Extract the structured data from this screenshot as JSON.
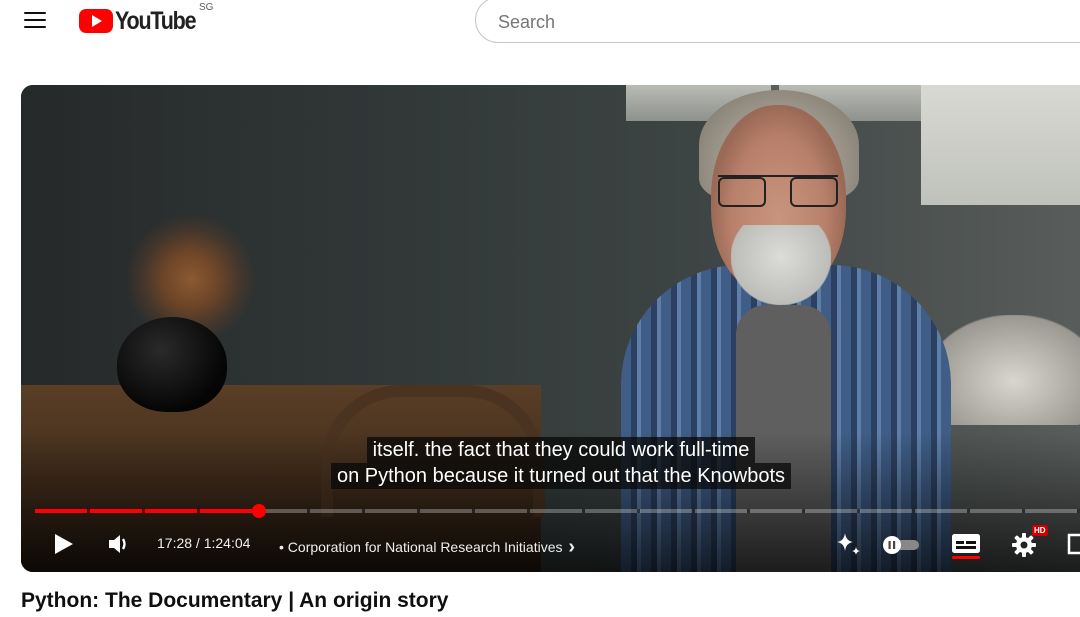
{
  "masthead": {
    "logo_text": "YouTube",
    "region_code": "SG",
    "search_placeholder": "Search"
  },
  "player": {
    "captions": [
      "itself. the fact that they could work full-time",
      "on Python because it turned out that the Knowbots"
    ],
    "current_time": "17:28",
    "duration": "1:24:04",
    "time_display": "17:28 / 1:24:04",
    "chapter_separator": "•",
    "chapter_title": "Corporation for National Research Initiatives",
    "chapter_chevron": "›",
    "progress_fraction": 0.2078,
    "hd_badge": "HD",
    "icons": [
      "play-icon",
      "volume-icon",
      "ai-sparkle-icon",
      "autoplay-toggle-icon",
      "subtitles-icon",
      "settings-icon",
      "miniplayer-icon"
    ],
    "accent_color": "#ff0000"
  },
  "video": {
    "title": "Python: The Documentary | An origin story"
  }
}
